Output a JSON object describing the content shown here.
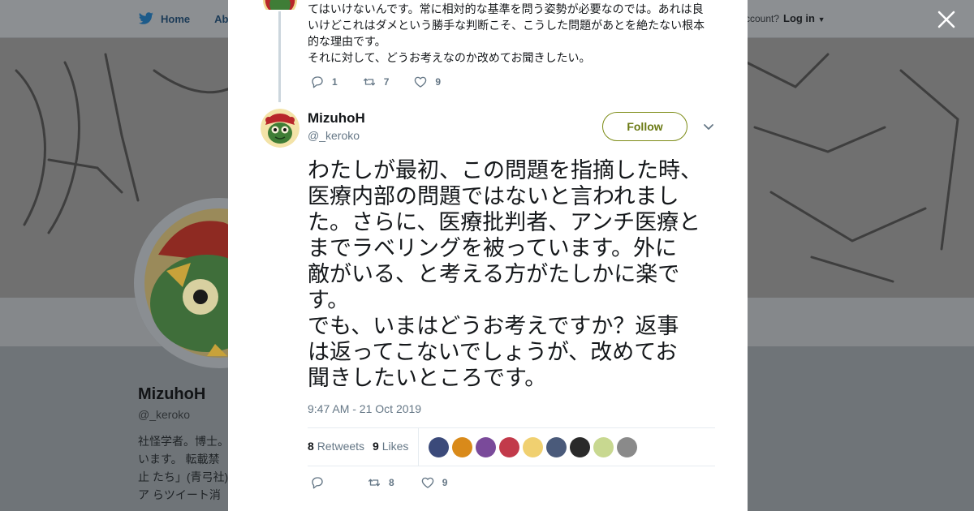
{
  "background": {
    "nav": {
      "home_label": "Home",
      "about_label": "Abo"
    },
    "account_text": "ccount?",
    "login_label": "Log in",
    "profile": {
      "name": "MizuhoH",
      "handle": "@_keroko",
      "bio": "社怪学者。博士。 います。 転載禁止 たち」(青弓社)ア らツイート消すっ"
    }
  },
  "modal": {
    "previous_tweet": {
      "text_lines": [
        "てはいけないんです。常に相対的な基準を問う姿勢が必要なのでは。あれは良",
        "いけどこれはダメという勝手な判断こそ、こうした問題があとを絶たない根本",
        "的な理由です。",
        "それに対して、どうお考えなのか改めてお聞きしたい。"
      ],
      "reply_count": "1",
      "retweet_count": "7",
      "like_count": "9"
    },
    "tweet": {
      "author_name": "MizuhoH",
      "author_handle": "@_keroko",
      "follow_label": "Follow",
      "text": "わたしが最初、この問題を指摘した時、\n医療内部の問題ではないと言われまし\nた。さらに、医療批判者、アンチ医療と\nまでラベリングを被っています。外に\n敵がいる、と考える方がたしかに楽で\nす。\nでも、いまはどうお考えですか？返事\nは返ってこないでしょうが、改めてお\n聞きしたいところです。",
      "timestamp": "9:47 AM - 21 Oct 2019",
      "retweets_count": "8",
      "retweets_label": "Retweets",
      "likes_count": "9",
      "likes_label": "Likes",
      "retweet_count_action": "8",
      "like_count_action": "9"
    },
    "liker_colors": [
      "#3b4a7a",
      "#d98a1a",
      "#7a4a9a",
      "#c23a4a",
      "#f0d070",
      "#4a5a7a",
      "#2a2a2a",
      "#c8d890",
      "#8a8a8a"
    ]
  },
  "colors": {
    "accent": "#7d8c17",
    "icon_gray": "#657786"
  }
}
